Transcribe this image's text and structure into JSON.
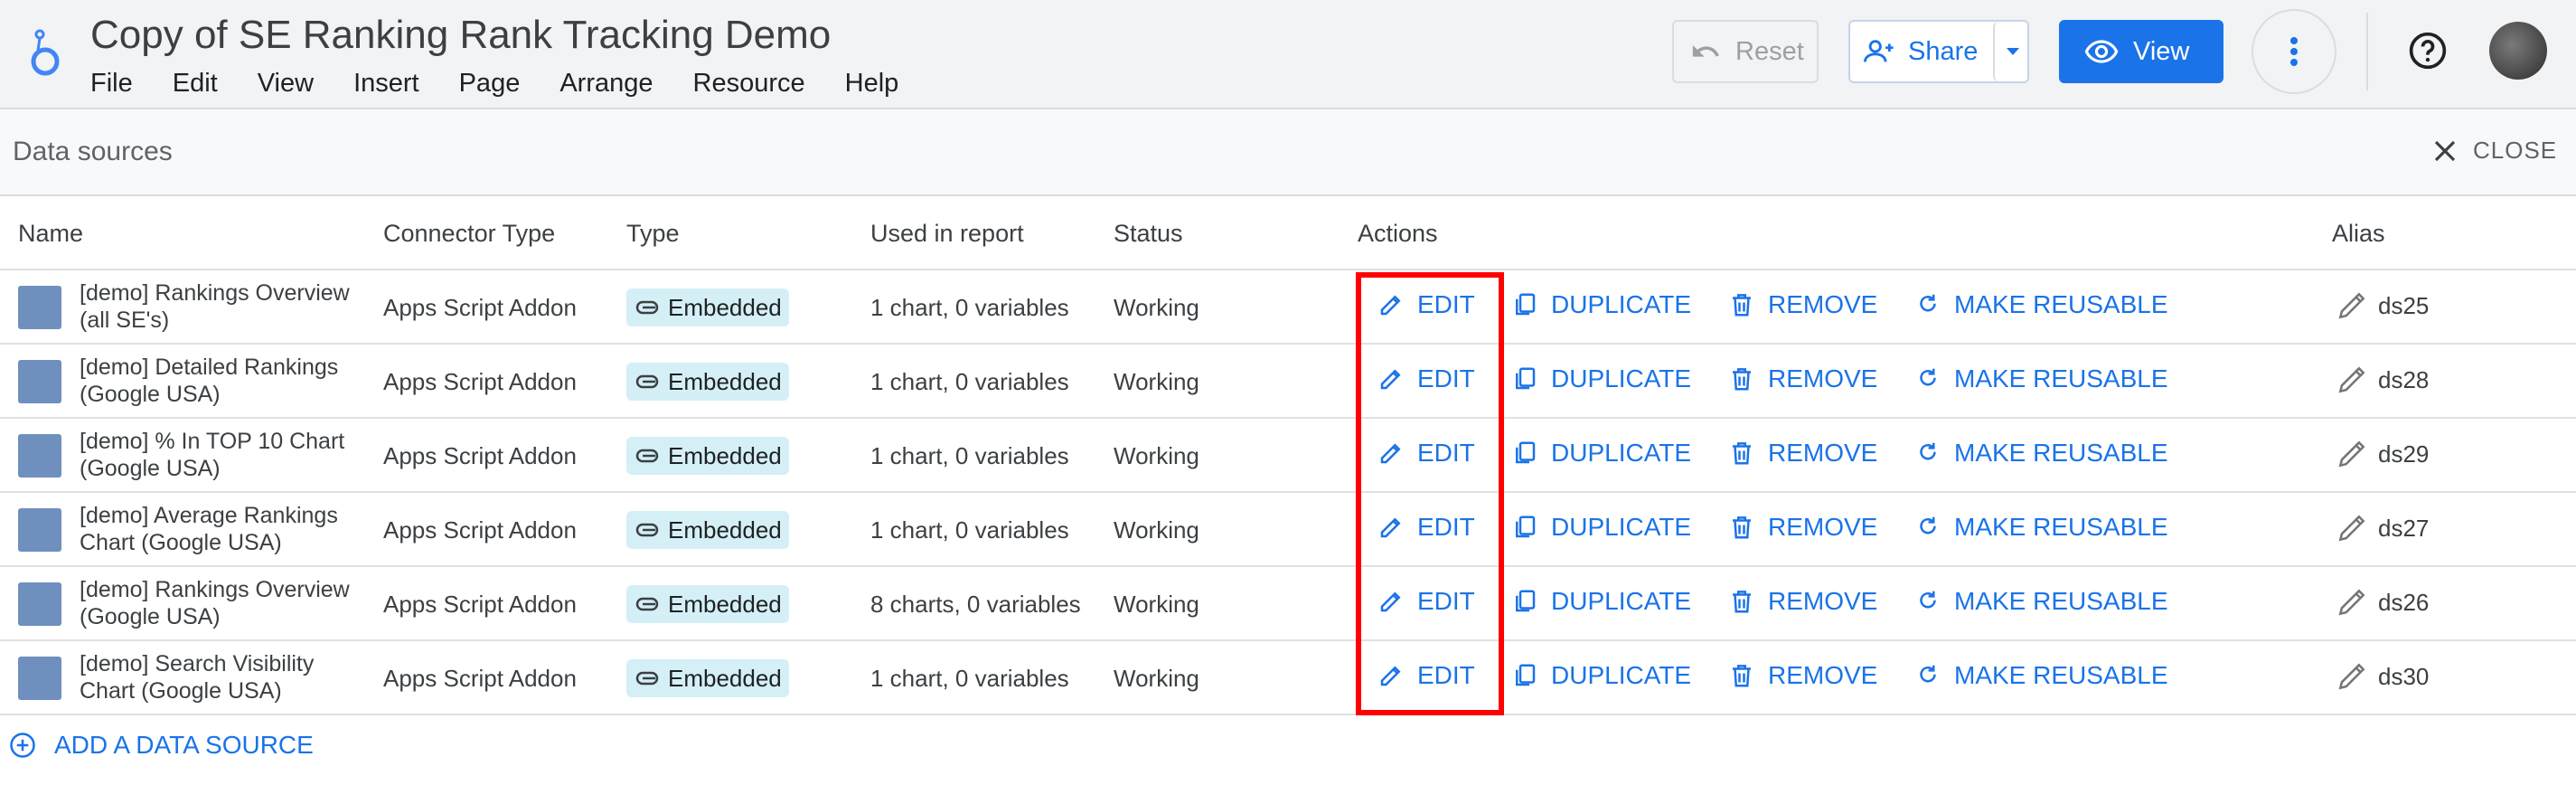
{
  "app": {
    "title": "Copy of SE Ranking Rank Tracking Demo",
    "menu": [
      "File",
      "Edit",
      "View",
      "Insert",
      "Page",
      "Arrange",
      "Resource",
      "Help"
    ],
    "reset_label": "Reset",
    "share_label": "Share",
    "view_label": "View",
    "colors": {
      "accent": "#1a73e8",
      "highlight": "#ff0000",
      "chip_bg": "#d4f0f6"
    }
  },
  "panel": {
    "title": "Data sources",
    "close_label": "CLOSE",
    "add_label": "ADD A DATA SOURCE"
  },
  "table": {
    "headers": [
      "Name",
      "Connector Type",
      "Type",
      "Used in report",
      "Status",
      "Actions",
      "Alias"
    ],
    "actions": {
      "edit": "EDIT",
      "duplicate": "DUPLICATE",
      "remove": "REMOVE",
      "reusable": "MAKE REUSABLE"
    },
    "rows": [
      {
        "name": "[demo] Rankings Overview (all SE's)",
        "connector": "Apps Script Addon",
        "type": "Embedded",
        "used": "1 chart, 0 variables",
        "status": "Working",
        "alias": "ds25"
      },
      {
        "name": "[demo] Detailed Rankings (Google USA)",
        "connector": "Apps Script Addon",
        "type": "Embedded",
        "used": "1 chart, 0 variables",
        "status": "Working",
        "alias": "ds28"
      },
      {
        "name": "[demo] % In TOP 10 Chart (Google USA)",
        "connector": "Apps Script Addon",
        "type": "Embedded",
        "used": "1 chart, 0 variables",
        "status": "Working",
        "alias": "ds29"
      },
      {
        "name": "[demo] Average Rankings Chart (Google USA)",
        "connector": "Apps Script Addon",
        "type": "Embedded",
        "used": "1 chart, 0 variables",
        "status": "Working",
        "alias": "ds27"
      },
      {
        "name": "[demo] Rankings Overview (Google USA)",
        "connector": "Apps Script Addon",
        "type": "Embedded",
        "used": "8 charts, 0 variables",
        "status": "Working",
        "alias": "ds26"
      },
      {
        "name": "[demo] Search Visibility Chart (Google USA)",
        "connector": "Apps Script Addon",
        "type": "Embedded",
        "used": "1 chart, 0 variables",
        "status": "Working",
        "alias": "ds30"
      }
    ]
  }
}
